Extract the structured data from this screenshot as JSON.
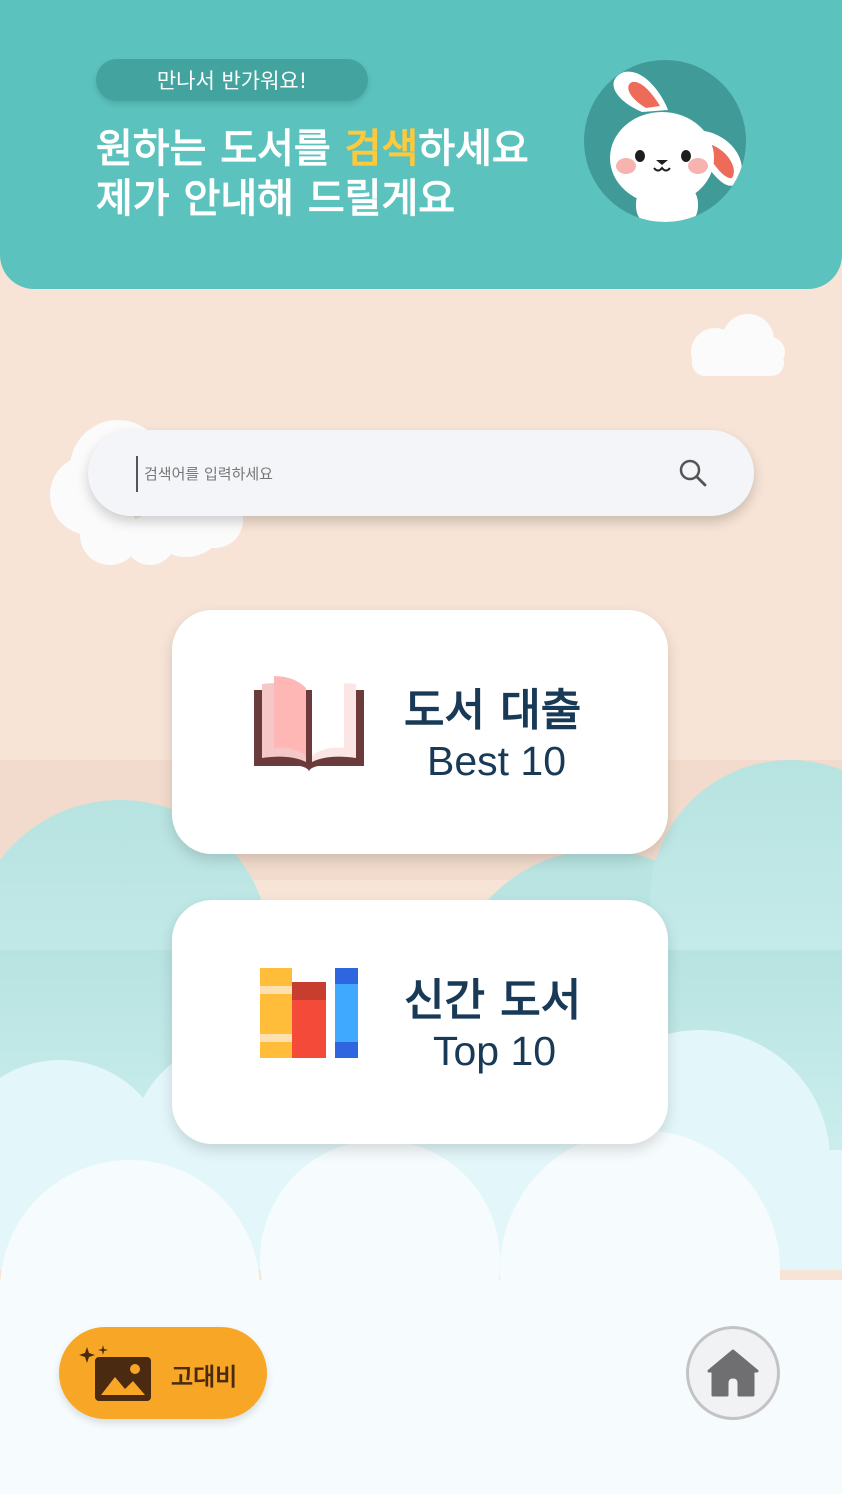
{
  "header": {
    "greeting": "만나서 반가워요!",
    "headline_prefix": "원하는 도서를 ",
    "headline_accent": "검색",
    "headline_suffix": "하세요",
    "headline_line2": "제가 안내해 드릴게요"
  },
  "search": {
    "placeholder": "검색어를 입력하세요",
    "value": ""
  },
  "cards": [
    {
      "title": "도서 대출",
      "subtitle": "Best 10",
      "icon": "open-book-icon"
    },
    {
      "title": "신간 도서",
      "subtitle": "Top 10",
      "icon": "books-icon"
    }
  ],
  "footer": {
    "contrast_label": "고대비",
    "contrast_icon": "image-sparkle-icon",
    "home_icon": "home-icon"
  },
  "colors": {
    "header_bg": "#5bc2bd",
    "accent": "#ffc93c",
    "text_dark": "#183a57",
    "contrast_button": "#f8a626",
    "background": "#f7e4d6"
  }
}
